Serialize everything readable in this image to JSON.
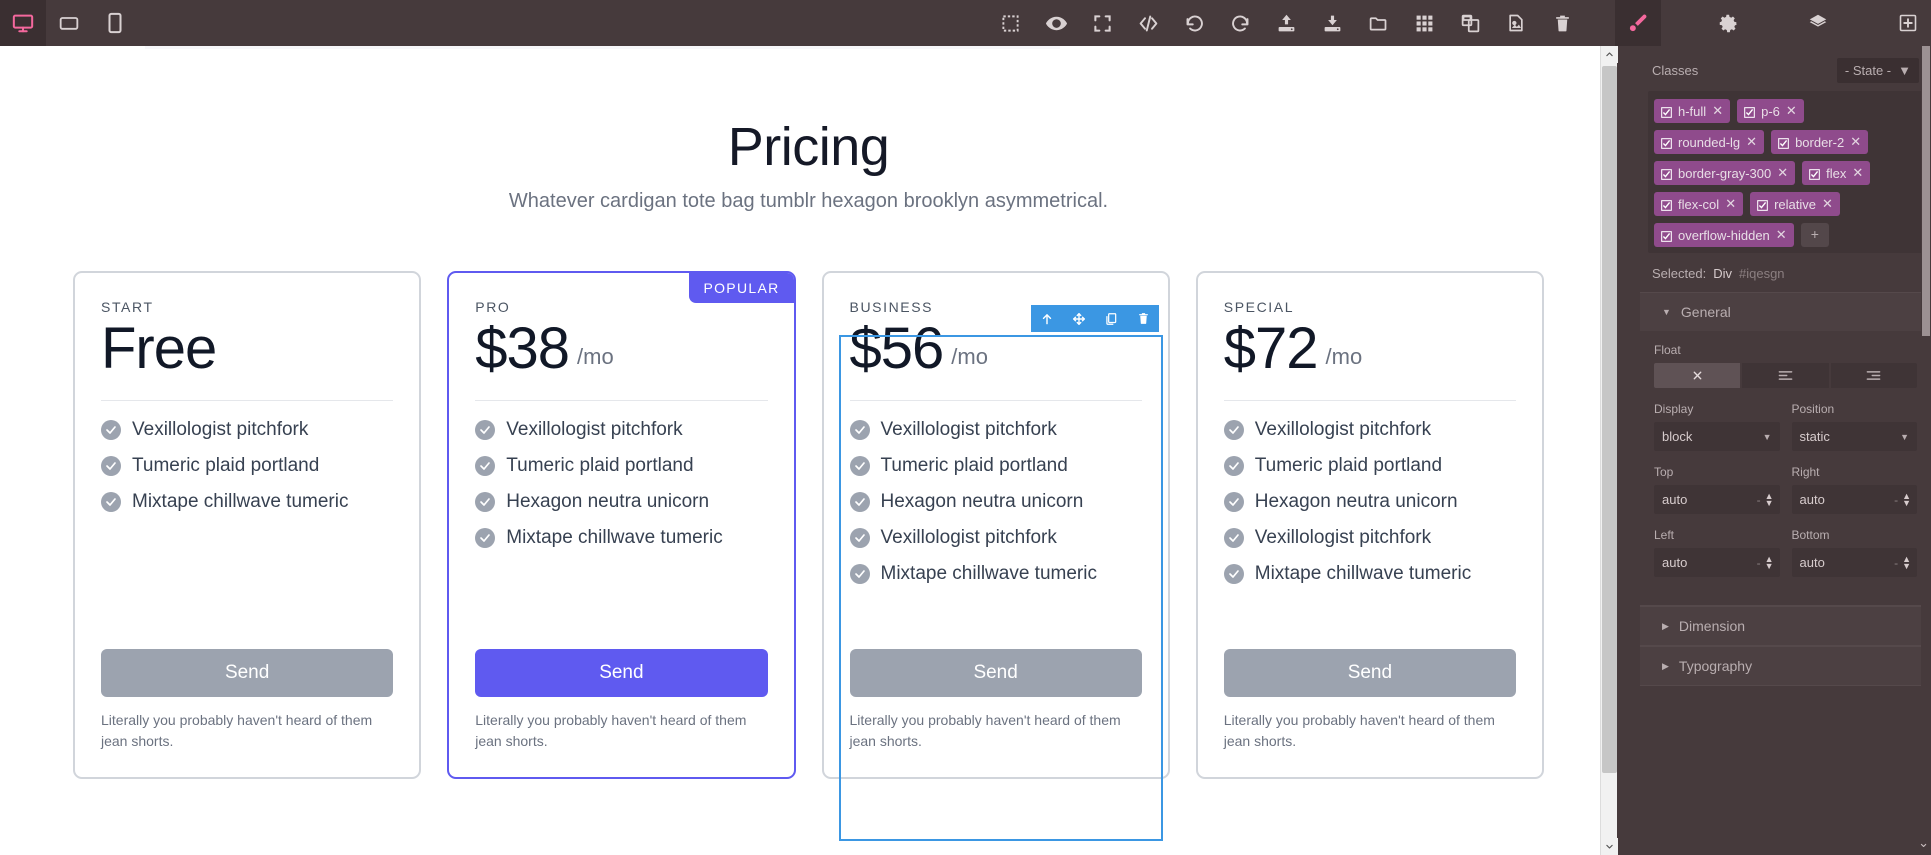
{
  "topbar": {
    "devices": [
      {
        "name": "desktop",
        "label": "Desktop",
        "active": true
      },
      {
        "name": "tablet",
        "label": "Tablet",
        "active": false
      },
      {
        "name": "mobile",
        "label": "Mobile",
        "active": false
      }
    ],
    "tools": [
      {
        "name": "borders",
        "label": "View components"
      },
      {
        "name": "preview",
        "label": "Preview"
      },
      {
        "name": "fullscreen",
        "label": "Fullscreen"
      },
      {
        "name": "code",
        "label": "View code"
      },
      {
        "name": "undo",
        "label": "Undo"
      },
      {
        "name": "redo",
        "label": "Redo"
      },
      {
        "name": "import",
        "label": "Import"
      },
      {
        "name": "export",
        "label": "Export"
      },
      {
        "name": "folder",
        "label": "Open"
      },
      {
        "name": "blocks",
        "label": "Open Blocks"
      },
      {
        "name": "pages",
        "label": "Pages"
      },
      {
        "name": "assets",
        "label": "Assets"
      },
      {
        "name": "trash",
        "label": "Clear canvas"
      },
      {
        "name": "brush",
        "label": "Open Style Manager",
        "active": true
      },
      {
        "name": "settings",
        "label": "Settings"
      },
      {
        "name": "layers",
        "label": "Open Layer Manager"
      },
      {
        "name": "add",
        "label": "Add"
      }
    ]
  },
  "canvas": {
    "title": "Pricing",
    "subtitle": "Whatever cardigan tote bag tumblr hexagon brooklyn asymmetrical.",
    "cards": [
      {
        "tier": "START",
        "price": "Free",
        "per": "",
        "badge": "",
        "highlight": false,
        "selected": false,
        "features": [
          "Vexillologist pitchfork",
          "Tumeric plaid portland",
          "Mixtape chillwave tumeric"
        ],
        "cta": "Send",
        "note": "Literally you probably haven't heard of them jean shorts."
      },
      {
        "tier": "PRO",
        "price": "$38",
        "per": "/mo",
        "badge": "POPULAR",
        "highlight": true,
        "selected": false,
        "features": [
          "Vexillologist pitchfork",
          "Tumeric plaid portland",
          "Hexagon neutra unicorn",
          "Mixtape chillwave tumeric"
        ],
        "cta": "Send",
        "note": "Literally you probably haven't heard of them jean shorts."
      },
      {
        "tier": "BUSINESS",
        "price": "$56",
        "per": "/mo",
        "badge": "",
        "highlight": false,
        "selected": true,
        "features": [
          "Vexillologist pitchfork",
          "Tumeric plaid portland",
          "Hexagon neutra unicorn",
          "Vexillologist pitchfork",
          "Mixtape chillwave tumeric"
        ],
        "cta": "Send",
        "note": "Literally you probably haven't heard of them jean shorts."
      },
      {
        "tier": "SPECIAL",
        "price": "$72",
        "per": "/mo",
        "badge": "",
        "highlight": false,
        "selected": false,
        "features": [
          "Vexillologist pitchfork",
          "Tumeric plaid portland",
          "Hexagon neutra unicorn",
          "Vexillologist pitchfork",
          "Mixtape chillwave tumeric"
        ],
        "cta": "Send",
        "note": "Literally you probably haven't heard of them jean shorts."
      }
    ],
    "selection_toolbar": [
      {
        "name": "select-parent",
        "label": "Select parent"
      },
      {
        "name": "move",
        "label": "Move"
      },
      {
        "name": "copy",
        "label": "Copy"
      },
      {
        "name": "delete",
        "label": "Delete"
      }
    ]
  },
  "right_panel": {
    "classes_label": "Classes",
    "state_label": "- State -",
    "classes": [
      "h-full",
      "p-6",
      "rounded-lg",
      "border-2",
      "border-gray-300",
      "flex",
      "flex-col",
      "relative",
      "overflow-hidden"
    ],
    "add_class_label": "+",
    "selected_label": "Selected:",
    "selected_tag": "Div",
    "selected_id": "#iqesgn",
    "sectors": [
      {
        "title": "General",
        "open": true
      },
      {
        "title": "Dimension",
        "open": false
      },
      {
        "title": "Typography",
        "open": false
      }
    ],
    "general": {
      "float_label": "Float",
      "float_options": [
        "none",
        "left",
        "right"
      ],
      "float_active": 0,
      "display_label": "Display",
      "display_value": "block",
      "position_label": "Position",
      "position_value": "static",
      "top_label": "Top",
      "top_value": "auto",
      "top_unit": "-",
      "right_label": "Right",
      "right_value": "auto",
      "right_unit": "-",
      "left_label": "Left",
      "left_value": "auto",
      "left_unit": "-",
      "bottom_label": "Bottom",
      "bottom_value": "auto",
      "bottom_unit": "-"
    }
  },
  "colors": {
    "chrome": "#463a3c",
    "accent_pink": "#f4689d",
    "chip_purple": "#8f4b8c",
    "selection_blue": "#3b97e3",
    "brand_indigo": "#5f5af0",
    "muted_gray": "#9ca3af"
  }
}
